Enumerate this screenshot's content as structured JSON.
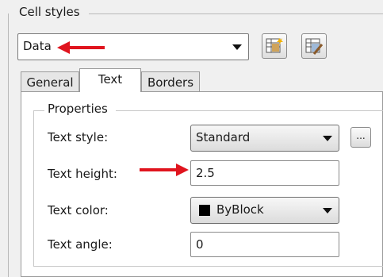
{
  "cell_styles": {
    "title": "Cell styles",
    "selected": "Data"
  },
  "tabs": [
    {
      "label": "General"
    },
    {
      "label": "Text"
    },
    {
      "label": "Borders"
    }
  ],
  "properties": {
    "title": "Properties",
    "text_style": {
      "label": "Text style:",
      "value": "Standard",
      "browse_label": "..."
    },
    "text_height": {
      "label": "Text height:",
      "value": "2.5"
    },
    "text_color": {
      "label": "Text color:",
      "value": "ByBlock",
      "swatch_color": "#000000"
    },
    "text_angle": {
      "label": "Text angle:",
      "value": "0"
    }
  },
  "colors": {
    "annotation_arrow": "#e0141e"
  },
  "icons": [
    "new-cell-style-icon",
    "manage-cell-styles-icon"
  ]
}
